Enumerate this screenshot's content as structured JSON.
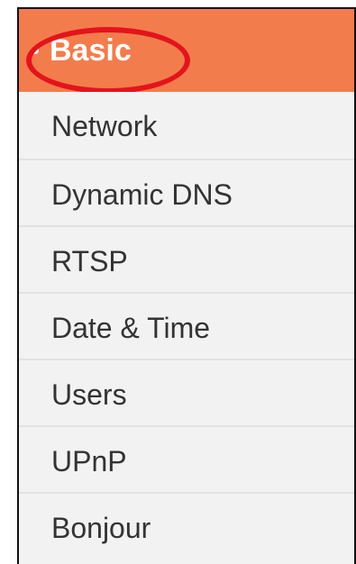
{
  "sidebar": {
    "active_section": {
      "label": "Basic",
      "bullet": "•",
      "color": "#f37c4c",
      "highlight_color": "#e3141c"
    },
    "items": [
      {
        "label": "Network"
      },
      {
        "label": "Dynamic DNS"
      },
      {
        "label": "RTSP"
      },
      {
        "label": "Date & Time"
      },
      {
        "label": "Users"
      },
      {
        "label": "UPnP"
      },
      {
        "label": "Bonjour"
      }
    ]
  }
}
